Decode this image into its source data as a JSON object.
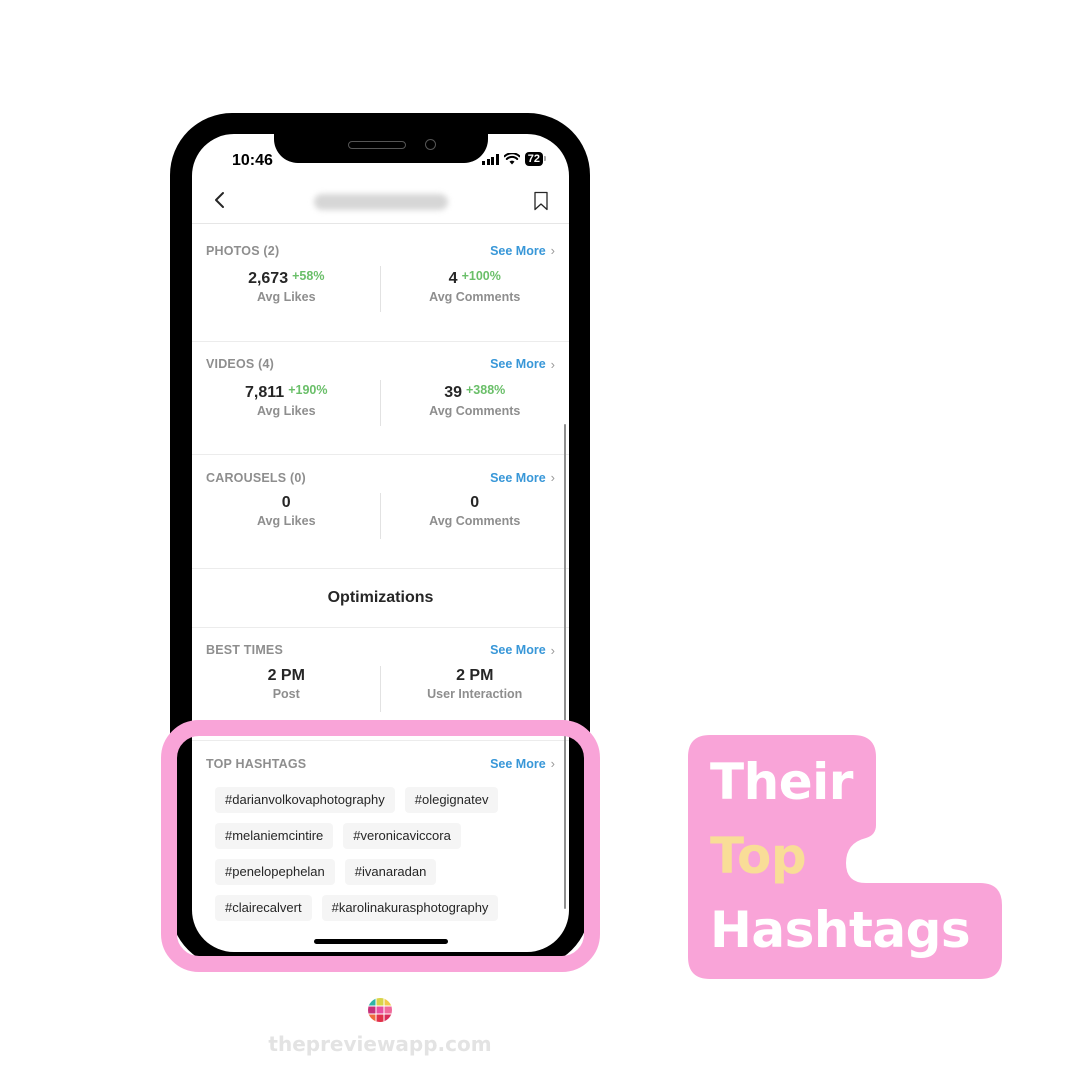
{
  "status_bar": {
    "time": "10:46",
    "battery": "72"
  },
  "navbar": {
    "back_icon": "chevron-left-icon",
    "bookmark_icon": "bookmark-icon"
  },
  "sections": [
    {
      "label": "PHOTOS (2)",
      "see_more": "See More",
      "stats": [
        {
          "value": "2,673",
          "change": "+58%",
          "label": "Avg Likes"
        },
        {
          "value": "4",
          "change": "+100%",
          "label": "Avg Comments"
        }
      ]
    },
    {
      "label": "VIDEOS (4)",
      "see_more": "See More",
      "stats": [
        {
          "value": "7,811",
          "change": "+190%",
          "label": "Avg Likes"
        },
        {
          "value": "39",
          "change": "+388%",
          "label": "Avg Comments"
        }
      ]
    },
    {
      "label": "CAROUSELS (0)",
      "see_more": "See More",
      "stats": [
        {
          "value": "0",
          "change": "",
          "label": "Avg Likes"
        },
        {
          "value": "0",
          "change": "",
          "label": "Avg Comments"
        }
      ]
    }
  ],
  "optimizations": {
    "title": "Optimizations",
    "best_times": {
      "label": "BEST TIMES",
      "see_more": "See More",
      "stats": [
        {
          "value": "2 PM",
          "label": "Post"
        },
        {
          "value": "2 PM",
          "label": "User Interaction"
        }
      ]
    }
  },
  "top_hashtags": {
    "label": "TOP HASHTAGS",
    "see_more": "See More",
    "tags": [
      "#darianvolkovaphotography",
      "#olegignatev",
      "#melaniemcintire",
      "#veronicaviccora",
      "#penelopephelan",
      "#ivanaradan",
      "#clairecalvert",
      "#karolinakurasphotography"
    ]
  },
  "caption": {
    "line1": "Their",
    "line2": "Top",
    "line3": "Hashtags"
  },
  "colors": {
    "highlight": "#f9a4d8",
    "accent_blue": "#3897d8",
    "positive_green": "#6abf69",
    "caption_yellow": "#f9dd97"
  },
  "footer": {
    "site": "thepreviewapp.com"
  }
}
